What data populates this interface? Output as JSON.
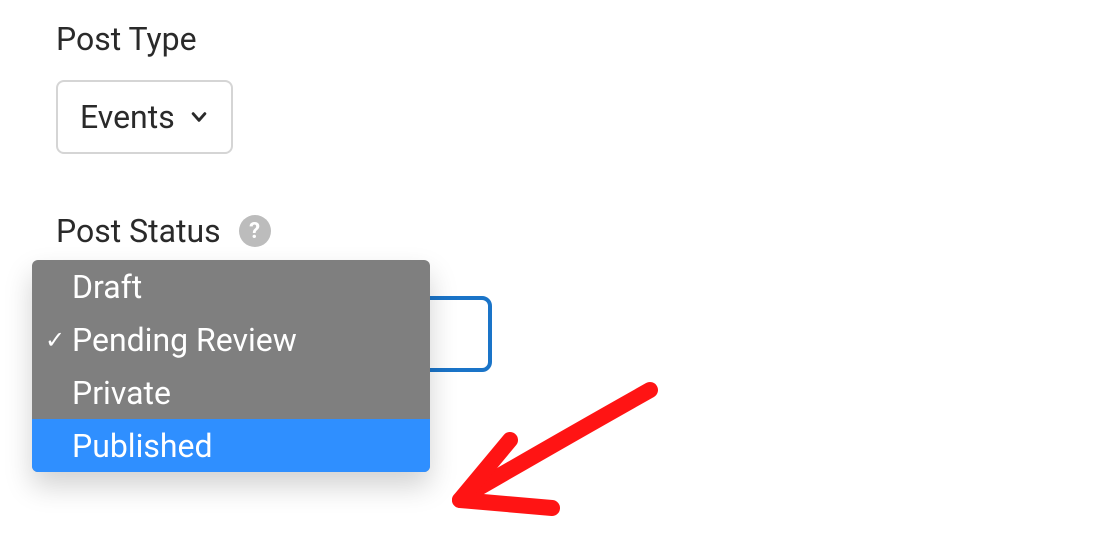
{
  "post_type": {
    "label": "Post Type",
    "selected": "Events"
  },
  "post_status": {
    "label": "Post Status",
    "options": [
      {
        "label": "Draft",
        "checked": false,
        "highlighted": false
      },
      {
        "label": "Pending Review",
        "checked": true,
        "highlighted": false
      },
      {
        "label": "Private",
        "checked": false,
        "highlighted": false
      },
      {
        "label": "Published",
        "checked": false,
        "highlighted": true
      }
    ]
  }
}
